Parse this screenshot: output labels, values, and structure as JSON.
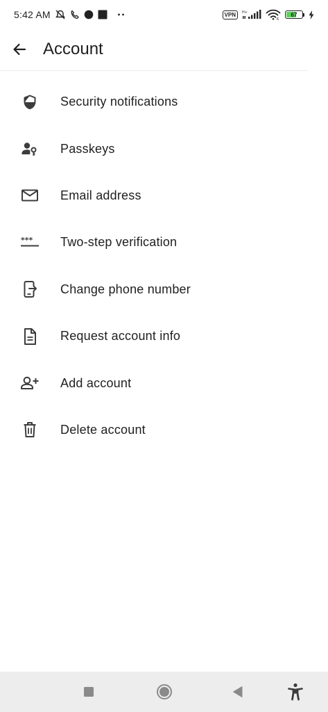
{
  "status_bar": {
    "time": "5:42 AM",
    "vpn_label": "VPN",
    "battery_level": "67",
    "battery_percent": 67
  },
  "app_bar": {
    "title": "Account",
    "back_icon": "arrow-left-icon"
  },
  "menu": {
    "items": [
      {
        "label": "Security notifications",
        "icon": "shield-icon"
      },
      {
        "label": "Passkeys",
        "icon": "person-key-icon"
      },
      {
        "label": "Email address",
        "icon": "envelope-icon"
      },
      {
        "label": "Two-step verification",
        "icon": "password-dots-icon"
      },
      {
        "label": "Change phone number",
        "icon": "phone-transfer-icon"
      },
      {
        "label": "Request account info",
        "icon": "document-icon"
      },
      {
        "label": "Add account",
        "icon": "person-add-icon"
      },
      {
        "label": "Delete account",
        "icon": "trash-icon"
      }
    ]
  },
  "nav_bar": {
    "recents_icon": "square-icon",
    "home_icon": "circle-icon",
    "back_icon": "triangle-back-icon",
    "accessibility_icon": "accessibility-icon"
  },
  "colors": {
    "background": "#ffffff",
    "text": "#1f1f1f",
    "icon": "#3c3c3c",
    "nav_bar": "#ededed",
    "battery_fill": "#5bd15b"
  }
}
